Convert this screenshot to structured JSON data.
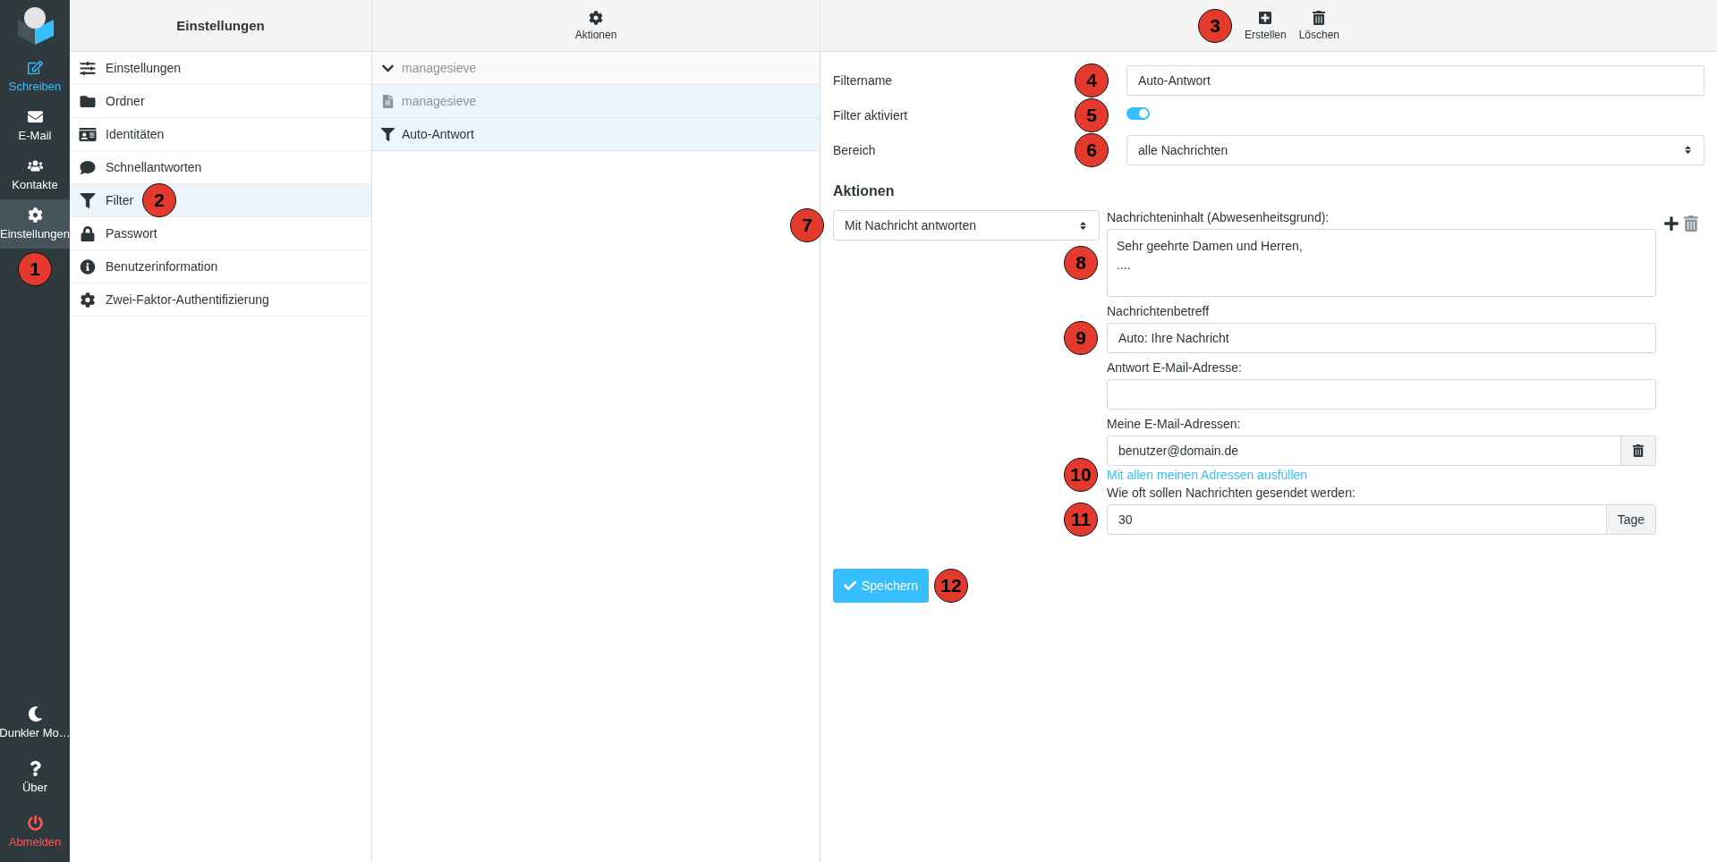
{
  "nav": {
    "items": [
      {
        "label": "Schreiben",
        "kind": "compose",
        "selected": false
      },
      {
        "label": "E-Mail",
        "kind": "normal",
        "selected": false
      },
      {
        "label": "Kontakte",
        "kind": "normal",
        "selected": false
      },
      {
        "label": "Einstellungen",
        "kind": "normal",
        "selected": true,
        "callout": "1"
      }
    ],
    "bottom": [
      {
        "label": "Dunkler Mo…",
        "kind": "normal"
      },
      {
        "label": "Über",
        "kind": "normal"
      },
      {
        "label": "Abmelden",
        "kind": "logout"
      }
    ]
  },
  "settings": {
    "title": "Einstellungen",
    "items": [
      {
        "label": "Einstellungen",
        "selected": false
      },
      {
        "label": "Ordner",
        "selected": false
      },
      {
        "label": "Identitäten",
        "selected": false
      },
      {
        "label": "Schnellantworten",
        "selected": false
      },
      {
        "label": "Filter",
        "selected": true,
        "callout": "2"
      },
      {
        "label": "Passwort",
        "selected": false
      },
      {
        "label": "Benutzerinformation",
        "selected": false
      },
      {
        "label": "Zwei-Faktor-Authentifizierung",
        "selected": false
      }
    ]
  },
  "filters_panel": {
    "action": "Aktionen",
    "folder": {
      "label": "managesieve",
      "expanded": true
    },
    "sets": [
      {
        "label": "managesieve",
        "selected": true,
        "active": false
      }
    ],
    "filters": [
      {
        "label": "Auto-Antwort",
        "selected": true
      }
    ]
  },
  "editor": {
    "toolbar": [
      {
        "label": "Erstellen"
      },
      {
        "label": "Löschen"
      }
    ],
    "toolbar_callout": "3",
    "filter_name": {
      "label": "Filtername",
      "value": "Auto-Antwort",
      "callout": "4"
    },
    "enabled": {
      "label": "Filter aktiviert",
      "on": true,
      "callout": "5"
    },
    "scope": {
      "label": "Bereich",
      "value": "alle Nachrichten",
      "callout": "6"
    },
    "actions_heading": "Aktionen",
    "action": {
      "type": "Mit Nachricht antworten",
      "callout": "7",
      "body": {
        "label": "Nachrichteninhalt (Abwesenheitsgrund):",
        "value": "Sehr geehrte Damen und Herren,\n....",
        "callout": "8"
      },
      "subject": {
        "label": "Nachrichtenbetreff",
        "value": "Auto: Ihre Nachricht",
        "callout": "9"
      },
      "reply_address": {
        "label": "Antwort E-Mail-Adresse:"
      },
      "my_addresses": {
        "label": "Meine E-Mail-Adressen:",
        "values": [
          "benutzer@domain.de"
        ]
      },
      "fill_link": {
        "label": "Mit allen meinen Adressen ausfüllen",
        "callout": "10"
      },
      "days": {
        "label": "Wie oft sollen Nachrichten gesendet werden:",
        "value": "30",
        "unit": "Tage",
        "callout": "11"
      }
    },
    "save": {
      "label": "Speichern",
      "callout": "12"
    }
  }
}
